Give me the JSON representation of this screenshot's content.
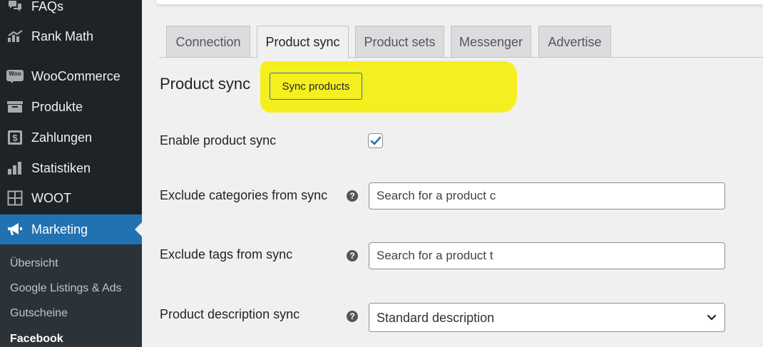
{
  "sidebar": {
    "menu": [
      {
        "label": "FAQs",
        "icon": "comments-icon"
      },
      {
        "label": "Rank Math",
        "icon": "rank-math-icon"
      },
      {
        "label": "WooCommerce",
        "icon": "woocommerce-icon"
      },
      {
        "label": "Produkte",
        "icon": "archive-icon"
      },
      {
        "label": "Zahlungen",
        "icon": "dollar-icon"
      },
      {
        "label": "Statistiken",
        "icon": "bar-chart-icon"
      },
      {
        "label": "WOOT",
        "icon": "grid-icon"
      },
      {
        "label": "Marketing",
        "icon": "megaphone-icon"
      }
    ],
    "submenu": [
      "Übersicht",
      "Google Listings & Ads",
      "Gutscheine",
      "Facebook"
    ],
    "woo_badge": "Woo"
  },
  "tabs": [
    "Connection",
    "Product sync",
    "Product sets",
    "Messenger",
    "Advertise"
  ],
  "active_tab": "Product sync",
  "section": {
    "title": "Product sync",
    "sync_button": "Sync products"
  },
  "settings": {
    "enable_label": "Enable product sync",
    "enable_checked": true,
    "exclude_categories_label": "Exclude categories from sync",
    "exclude_categories_placeholder": "Search for a product c",
    "exclude_tags_label": "Exclude tags from sync",
    "exclude_tags_placeholder": "Search for a product t",
    "description_label": "Product description sync",
    "description_value": "Standard description",
    "help_glyph": "?"
  },
  "colors": {
    "sidebar_bg": "#1d2327",
    "active_menu": "#2271b1",
    "highlight": "#f6ef1f",
    "page_bg": "#f0f0f1"
  }
}
